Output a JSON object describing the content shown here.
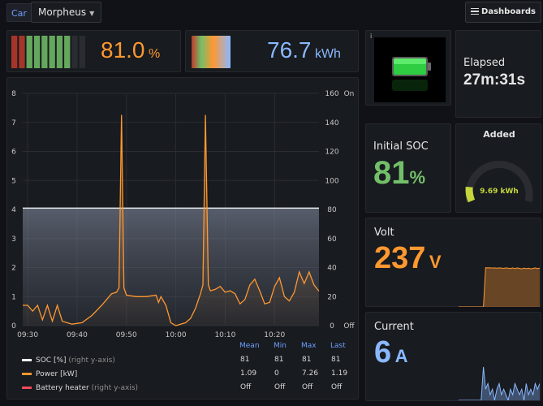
{
  "topbar": {
    "tag": "Car",
    "variable_value": "Morpheus",
    "dashboards_label": "Dashboards"
  },
  "battery_level": {
    "value": "81.0",
    "unit": "%",
    "fill_fraction": 0.81
  },
  "energy": {
    "value": "76.7",
    "unit": "kWh"
  },
  "info_icon": "i",
  "elapsed": {
    "title": "Elapsed",
    "value": "27m:31s"
  },
  "initial_soc": {
    "title": "Initial SOC",
    "value": "81",
    "unit": "%"
  },
  "added": {
    "title": "Added",
    "value": "9.69 kWh",
    "gauge_fraction": 0.12
  },
  "volt": {
    "title": "Volt",
    "value": "237",
    "unit": "V"
  },
  "current": {
    "title": "Current",
    "value": "6",
    "unit": "A"
  },
  "colors": {
    "orange": "#ff9830",
    "green": "#73bf69",
    "blue": "#8ab8ff",
    "red": "#f2495c",
    "white": "#ffffff"
  },
  "chart_data": {
    "type": "line",
    "x_ticks": [
      "09:30",
      "09:40",
      "09:50",
      "10:00",
      "10:10",
      "10:20"
    ],
    "left_axis": {
      "ticks": [
        "0",
        "1",
        "2",
        "3",
        "4",
        "5",
        "6",
        "7",
        "8"
      ],
      "ylim": [
        0,
        8
      ]
    },
    "right_axis": {
      "ticks": [
        "0",
        "20",
        "40",
        "60",
        "80",
        "100",
        "120",
        "140",
        "160"
      ],
      "ylim": [
        0,
        160
      ],
      "off_label": "Off",
      "on_label": "On"
    },
    "series": [
      {
        "name": "SOC [%]",
        "axis_note": "(right y-axis)",
        "color": "#ffffff",
        "points": [
          [
            0,
            81
          ],
          [
            60,
            81
          ]
        ],
        "mean": "81",
        "min": "81",
        "max": "81",
        "last": "81"
      },
      {
        "name": "Power [kW]",
        "axis_note": "",
        "color": "#ff9830",
        "points": [
          [
            0,
            0.7
          ],
          [
            1,
            0.7
          ],
          [
            2,
            0.5
          ],
          [
            3,
            0.7
          ],
          [
            4,
            0.2
          ],
          [
            5,
            0.7
          ],
          [
            6,
            0.15
          ],
          [
            7,
            0.7
          ],
          [
            8,
            0.15
          ],
          [
            10,
            0.05
          ],
          [
            12,
            0.1
          ],
          [
            14,
            0.35
          ],
          [
            16,
            0.7
          ],
          [
            18,
            1.1
          ],
          [
            19,
            1.15
          ],
          [
            19.5,
            1.3
          ],
          [
            20,
            7.26
          ],
          [
            20.5,
            1.3
          ],
          [
            21,
            1.05
          ],
          [
            23,
            1.0
          ],
          [
            25,
            1.0
          ],
          [
            27,
            1.05
          ],
          [
            27.5,
            0.8
          ],
          [
            28,
            1.0
          ],
          [
            29,
            0.7
          ],
          [
            30,
            0.1
          ],
          [
            31,
            0.0
          ],
          [
            33,
            0.1
          ],
          [
            34,
            0.25
          ],
          [
            35,
            0.6
          ],
          [
            36,
            1.1
          ],
          [
            36.5,
            1.4
          ],
          [
            37,
            7.26
          ],
          [
            37.6,
            1.4
          ],
          [
            38,
            1.2
          ],
          [
            39,
            1.25
          ],
          [
            40,
            1.35
          ],
          [
            41,
            1.15
          ],
          [
            42,
            1.2
          ],
          [
            43,
            1.1
          ],
          [
            44,
            0.75
          ],
          [
            45,
            0.9
          ],
          [
            46,
            1.4
          ],
          [
            47,
            1.6
          ],
          [
            48,
            1.2
          ],
          [
            49,
            0.75
          ],
          [
            50,
            0.8
          ],
          [
            51,
            1.35
          ],
          [
            52,
            1.65
          ],
          [
            53,
            1.0
          ],
          [
            54,
            0.85
          ],
          [
            55,
            1.15
          ],
          [
            56,
            1.85
          ],
          [
            57,
            1.45
          ],
          [
            58,
            1.85
          ],
          [
            59,
            1.4
          ],
          [
            60,
            1.19
          ]
        ],
        "mean": "1.09",
        "min": "0",
        "max": "7.26",
        "last": "1.19"
      },
      {
        "name": "Battery heater",
        "axis_note": "(right y-axis)",
        "color": "#f2495c",
        "points": [],
        "mean": "Off",
        "min": "Off",
        "max": "Off",
        "last": "Off"
      }
    ],
    "legend_headers": [
      "Mean",
      "Min",
      "Max",
      "Last"
    ],
    "x_range_minutes": [
      0,
      60
    ]
  },
  "volt_spark": [
    0,
    0,
    0,
    0,
    0,
    0,
    0,
    0,
    0,
    0,
    0,
    0,
    237,
    236,
    237,
    235,
    236,
    234,
    236,
    235,
    233,
    236,
    234,
    232,
    236,
    231,
    236,
    233,
    230,
    235,
    231,
    234,
    230,
    233,
    236,
    232,
    234
  ],
  "current_spark": [
    0,
    0,
    0,
    0,
    0,
    0,
    0,
    0,
    0,
    0,
    0,
    6,
    2,
    3,
    1,
    2,
    0,
    2,
    3,
    1,
    2,
    1,
    0,
    2,
    1,
    3,
    2,
    1,
    2,
    0,
    3,
    1,
    2,
    1,
    3,
    2,
    3
  ]
}
